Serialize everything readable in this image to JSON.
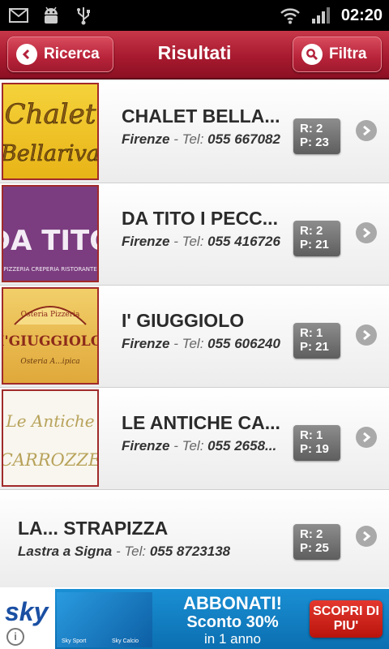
{
  "status_bar": {
    "time": "02:20",
    "left_icons": [
      "gmail-icon",
      "android-debug-icon",
      "usb-icon"
    ],
    "right_icons": [
      "wifi-icon",
      "signal-icon"
    ]
  },
  "header": {
    "back_label": "Ricerca",
    "title": "Risultati",
    "filter_label": "Filtra"
  },
  "results": [
    {
      "name": "CHALET BELLA...",
      "city": "Firenze",
      "tel_label": " - Tel: ",
      "phone": "055 667082",
      "r": "R: 2",
      "p": "P: 23",
      "logo_lines": [
        "Chalet",
        "Bellariva"
      ]
    },
    {
      "name": "DA TITO I PECC...",
      "city": "Firenze",
      "tel_label": " - Tel: ",
      "phone": "055 416726",
      "r": "R: 2",
      "p": "P: 21",
      "logo_lines": [
        "DA TITO",
        "PIZZERIA CREPERIA RISTORANTE"
      ]
    },
    {
      "name": "I' GIUGGIOLO",
      "city": "Firenze",
      "tel_label": " - Tel: ",
      "phone": "055 606240",
      "r": "R: 1",
      "p": "P: 21",
      "logo_lines": [
        "Osteria Pizzeria",
        "I'GIUGGIOLO",
        "Osteria A...ipica"
      ]
    },
    {
      "name": "LE ANTICHE CA...",
      "city": "Firenze",
      "tel_label": " - Tel: ",
      "phone": "055 2658...",
      "r": "R: 1",
      "p": "P: 19",
      "logo_lines": [
        "Le Antiche",
        "CARROZZE"
      ]
    },
    {
      "name": "LA... STRAPIZZA",
      "city": "Lastra a Signa",
      "tel_label": " - Tel: ",
      "phone": "055 8723138",
      "r": "R: 2",
      "p": "P: 25"
    }
  ],
  "ad": {
    "brand": "sky",
    "tile_left": "Sky Sport",
    "tile_right": "Sky Calcio",
    "line1": "ABBONATI!",
    "line2": "Sconto 30%",
    "line3": "in 1 anno",
    "cta": "SCOPRI DI PIU'",
    "info_glyph": "i"
  },
  "colors": {
    "header_red": "#a81a2f",
    "badge_gray": "#6e6e6e",
    "ad_blue": "#0b6fb0",
    "cta_red": "#d0241b"
  }
}
